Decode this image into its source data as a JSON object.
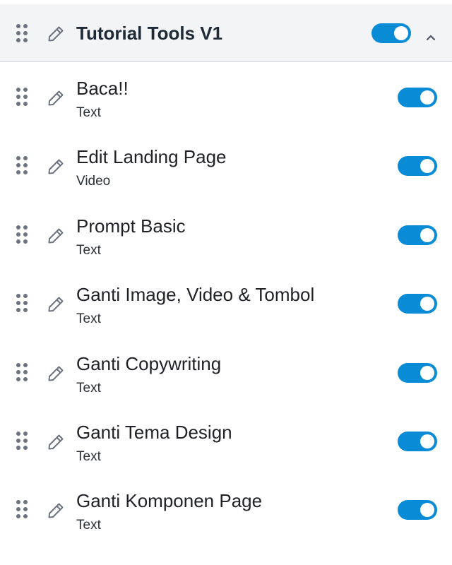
{
  "header": {
    "title": "Tutorial Tools V1",
    "enabled": true,
    "drag_icon": "drag-handle-icon",
    "edit_icon": "pencil-icon",
    "collapse_icon": "chevron-up-icon"
  },
  "items": [
    {
      "title": "Baca!!",
      "type": "Text",
      "enabled": true
    },
    {
      "title": "Edit Landing Page",
      "type": "Video",
      "enabled": true
    },
    {
      "title": "Prompt Basic",
      "type": "Text",
      "enabled": true
    },
    {
      "title": "Ganti Image, Video & Tombol",
      "type": "Text",
      "enabled": true
    },
    {
      "title": "Ganti Copywriting",
      "type": "Text",
      "enabled": true
    },
    {
      "title": "Ganti Tema Design",
      "type": "Text",
      "enabled": true
    },
    {
      "title": "Ganti Komponen Page",
      "type": "Text",
      "enabled": true
    }
  ],
  "colors": {
    "toggle_on": "#0a8bd6",
    "header_bg": "#f3f4f6",
    "icon_gray": "#6b7280"
  }
}
